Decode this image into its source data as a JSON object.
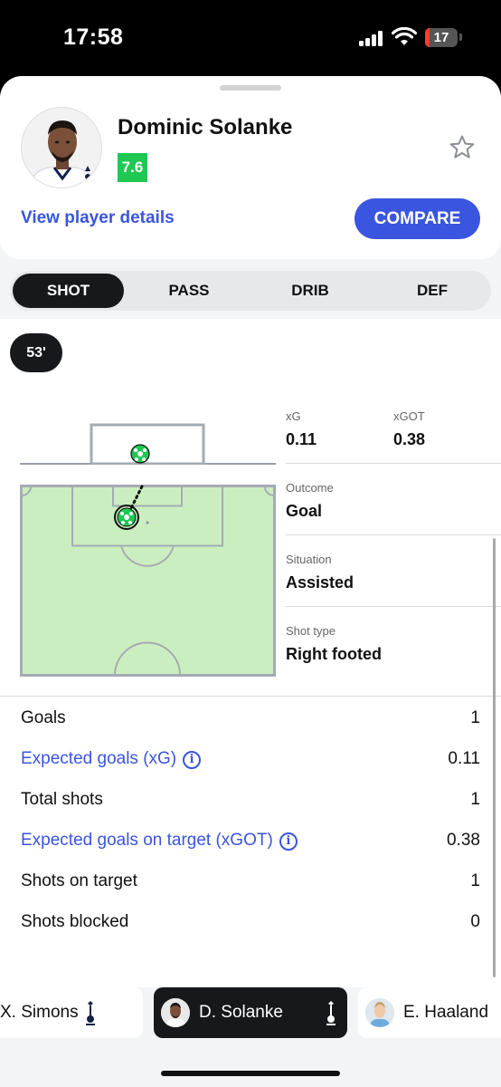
{
  "status": {
    "time": "17:58",
    "battery": "17"
  },
  "header": {
    "player_name": "Dominic Solanke",
    "rating": "7.6",
    "rating_color": "#1ec853",
    "view_details_label": "View player details",
    "compare_label": "COMPARE",
    "accent": "#3a55df",
    "favorite_icon": "star-outline-icon"
  },
  "tabs": [
    {
      "label": "SHOT",
      "active": true
    },
    {
      "label": "PASS",
      "active": false
    },
    {
      "label": "DRIB",
      "active": false
    },
    {
      "label": "DEF",
      "active": false
    }
  ],
  "shot": {
    "minute": "53'",
    "xg_label": "xG",
    "xg_value": "0.11",
    "xgot_label": "xGOT",
    "xgot_value": "0.38",
    "outcome_label": "Outcome",
    "outcome_value": "Goal",
    "situation_label": "Situation",
    "situation_value": "Assisted",
    "shot_type_label": "Shot type",
    "shot_type_value": "Right footed",
    "pitch_color": "#cbeec0",
    "ball_color": "#1ec853"
  },
  "stats": [
    {
      "label": "Goals",
      "value": "1",
      "link": false
    },
    {
      "label": "Expected goals (xG)",
      "value": "0.11",
      "link": true
    },
    {
      "label": "Total shots",
      "value": "1",
      "link": false
    },
    {
      "label": "Expected goals on target (xGOT)",
      "value": "0.38",
      "link": true
    },
    {
      "label": "Shots on target",
      "value": "1",
      "link": false
    },
    {
      "label": "Shots blocked",
      "value": "0",
      "link": false
    }
  ],
  "players": [
    {
      "label": "X. Simons",
      "active": false
    },
    {
      "label": "D. Solanke",
      "active": true
    },
    {
      "label": "E. Haaland",
      "active": false
    }
  ]
}
